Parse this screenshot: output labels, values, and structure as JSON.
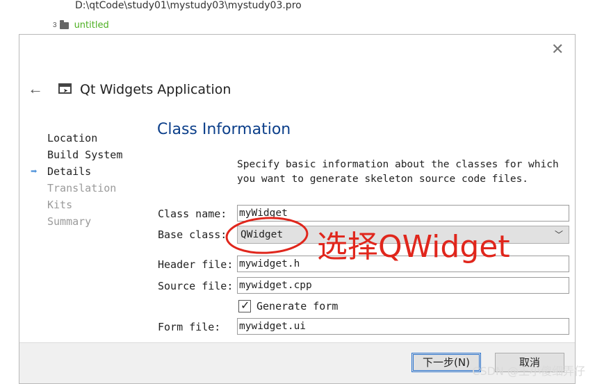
{
  "background": {
    "path": "D:\\qtCode\\study01\\mystudy03\\mystudy03.pro",
    "row_number": "3",
    "folder_name": "untitled"
  },
  "dialog": {
    "close_icon": "✕",
    "back_icon": "🡐",
    "app_icon_glyph": "➤",
    "title": "Qt Widgets Application",
    "steps": [
      {
        "label": "Location"
      },
      {
        "label": "Build System"
      },
      {
        "label": "Details"
      },
      {
        "label": "Translation"
      },
      {
        "label": "Kits"
      },
      {
        "label": "Summary"
      }
    ],
    "current_step_marker": "➡",
    "section_title": "Class Information",
    "description": "Specify basic information about the classes for which you want to generate skeleton source code files.",
    "form": {
      "class_name_label": "Class name:",
      "class_name_value": "myWidget",
      "base_class_label": "Base class:",
      "base_class_value": "QWidget",
      "header_file_label": "Header file:",
      "header_file_value": "mywidget.h",
      "source_file_label": "Source file:",
      "source_file_value": "mywidget.cpp",
      "generate_form_label": "Generate form",
      "generate_form_checked": "✓",
      "form_file_label": "Form file:",
      "form_file_value": "mywidget.ui"
    },
    "buttons": {
      "next": "下一步(N)",
      "cancel": "取消"
    }
  },
  "annotation": {
    "text": "选择QWidget",
    "color": "#e0261c"
  },
  "watermark": "CSDN @王小傻细弄仔",
  "colors": {
    "section_title": "#0c3f8a",
    "step_marker": "#4a90d9",
    "folder_text": "#4caf20"
  }
}
